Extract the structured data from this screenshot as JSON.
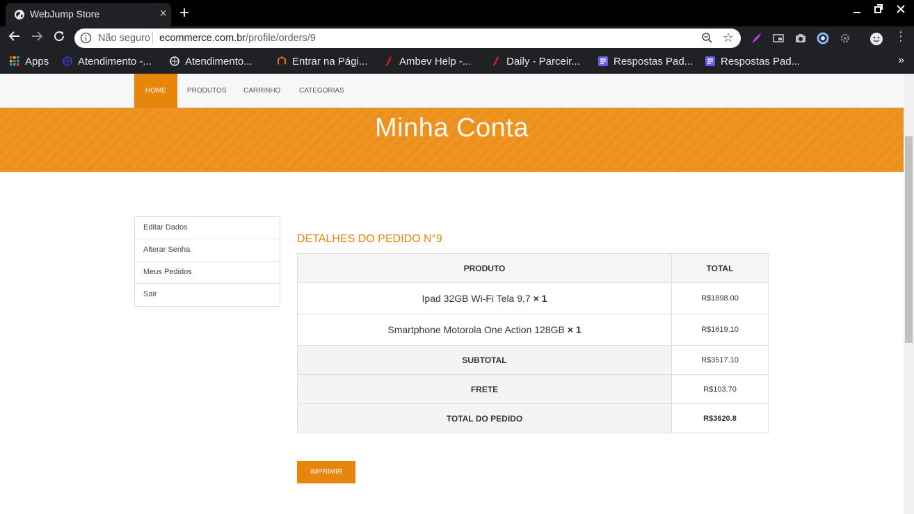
{
  "browser": {
    "tab_title": "WebJump Store",
    "tab_close": "×",
    "new_tab": "+",
    "address": {
      "security": "Não seguro",
      "host": "ecommerce.com.br",
      "path": "/profile/orders/9"
    },
    "bookmarks": [
      {
        "label": "Apps",
        "icon": "apps-grid-icon",
        "color": "#4285f4"
      },
      {
        "label": "Atendimento -...",
        "icon": "globe-icon",
        "color": "#3b3bd6"
      },
      {
        "label": "Atendimento...",
        "icon": "globe-icon",
        "color": "#e8eaed"
      },
      {
        "label": "Entrar na Pági...",
        "icon": "magento-icon",
        "color": "#f26322"
      },
      {
        "label": "Ambev Help -...",
        "icon": "slash-icon",
        "color": "#e02020"
      },
      {
        "label": "Daily - Parceir...",
        "icon": "slash-icon",
        "color": "#e02020"
      },
      {
        "label": "Respostas Pad...",
        "icon": "doc-icon",
        "color": "#6b5bf5"
      },
      {
        "label": "Respostas Pad...",
        "icon": "doc-icon",
        "color": "#6b5bf5"
      }
    ],
    "bookmarks_more": "»"
  },
  "site": {
    "nav": [
      "HOME",
      "PRODUTOS",
      "CARRINHO",
      "CATEGORIAS"
    ],
    "active_nav": "HOME",
    "accent": "#e8850b",
    "banner_title": "Minha Conta",
    "sidebar": [
      "Editar Dados",
      "Alterar Senha",
      "Meus Pedidos",
      "Sair"
    ],
    "order": {
      "title": "DETALHES DO PEDIDO N°9",
      "headers": {
        "product": "PRODUTO",
        "total": "TOTAL"
      },
      "items": [
        {
          "name": "Ipad 32GB Wi-Fi Tela 9,7",
          "qty": "× 1",
          "total": "R$1898.00"
        },
        {
          "name": "Smartphone Motorola One Action 128GB",
          "qty": "× 1",
          "total": "R$1619.10"
        }
      ],
      "summary": [
        {
          "label": "SUBTOTAL",
          "value": "R$3517.10"
        },
        {
          "label": "FRETE",
          "value": "R$103.70"
        },
        {
          "label": "TOTAL DO PEDIDO",
          "value": "R$3620.8"
        }
      ],
      "print_label": "IMPRIMIR"
    }
  }
}
